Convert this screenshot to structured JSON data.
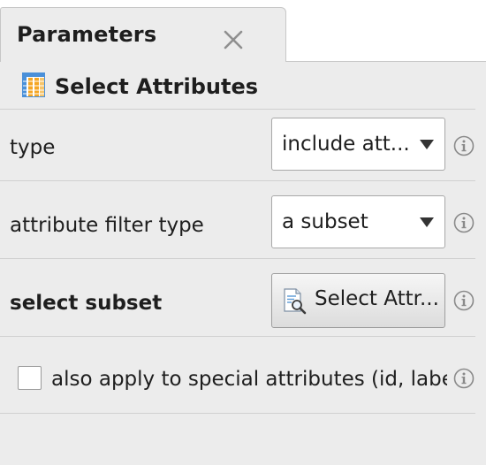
{
  "tab": {
    "title": "Parameters",
    "close_icon": "close-icon"
  },
  "operator": {
    "title": "Select Attributes",
    "icon": "table-columns-icon"
  },
  "params": {
    "type": {
      "label": "type",
      "value": "include att..."
    },
    "filter_type": {
      "label": "attribute filter type",
      "value": "a subset"
    },
    "subset": {
      "label": "select subset",
      "button_label": "Select Attr...",
      "button_icon": "document-search-icon"
    },
    "special": {
      "label": "also apply to special attributes (id, label..",
      "checked": false
    }
  },
  "info_icon": "info-icon"
}
